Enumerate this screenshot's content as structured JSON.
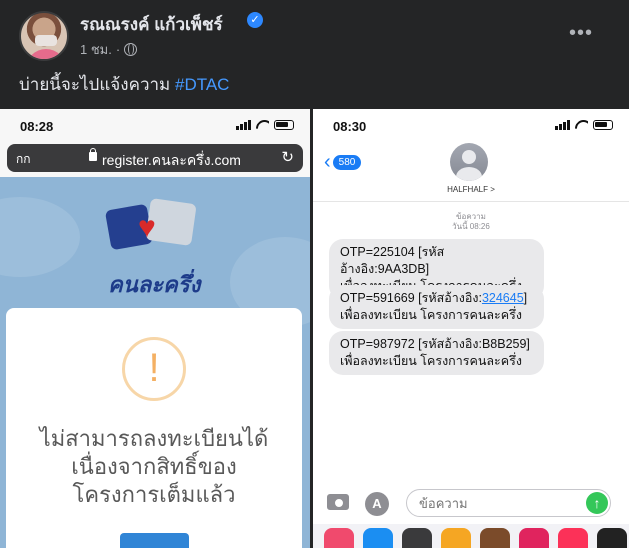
{
  "post": {
    "author": "รณณรงค์ แก้วเพ็ชร์",
    "time": "1 ชม.",
    "separator": "·",
    "caption_text": "บ่ายนี้จะไปแจ้งความ",
    "hashtag": "#DTAC",
    "more_icon": "more-horizontal-icon",
    "verified_icon": "verified-badge-icon",
    "privacy_icon": "globe-icon"
  },
  "left_phone": {
    "status_time": "08:28",
    "url_aa": "กก",
    "url": "register.คนละครึ่ง.com",
    "site_title": "คนละครึ่ง",
    "modal": {
      "icon": "!",
      "text_line1": "ไม่สามารถลงทะเบียนได้",
      "text_line2": "เนื่องจากสิทธิ์ของ",
      "text_line3": "โครงการเต็มแล้ว"
    }
  },
  "right_phone": {
    "status_time": "08:30",
    "back_count": "580",
    "contact_name": "HALFHALF >",
    "date_line1": "ข้อความ",
    "date_line2": "วันนี้ 08:26",
    "messages": [
      {
        "line1_prefix": "OTP=225104 [รหัสอ้างอิง:9AA3DB]",
        "line1_link": "",
        "line1_suffix": "",
        "line2": "เพื่อลงทะเบียน โครงการคนละครึ่ง"
      },
      {
        "line1_prefix": "OTP=591669 [รหัสอ้างอิง:",
        "line1_link": "324645",
        "line1_suffix": "]",
        "line2": "เพื่อลงทะเบียน โครงการคนละครึ่ง"
      },
      {
        "line1_prefix": "OTP=987972 [รหัสอ้างอิง:B8B259]",
        "line1_link": "",
        "line1_suffix": "",
        "line2": "เพื่อลงทะเบียน โครงการคนละครึ่ง"
      }
    ],
    "input_placeholder": "ข้อความ",
    "app_tray_colors": [
      "#f04a6d",
      "#1b8ef2",
      "#3a3a3c",
      "#f5a623",
      "#7b4b2a",
      "#e0245e",
      "#fc3158",
      "#222222"
    ]
  },
  "colors": {
    "fb_background": "#242526",
    "hashtag": "#4599ff",
    "imessage_blue": "#1a7cf5",
    "bubble_gray": "#e9e9eb",
    "modal_button": "#3085d6",
    "warn_orange": "#f4b063"
  }
}
